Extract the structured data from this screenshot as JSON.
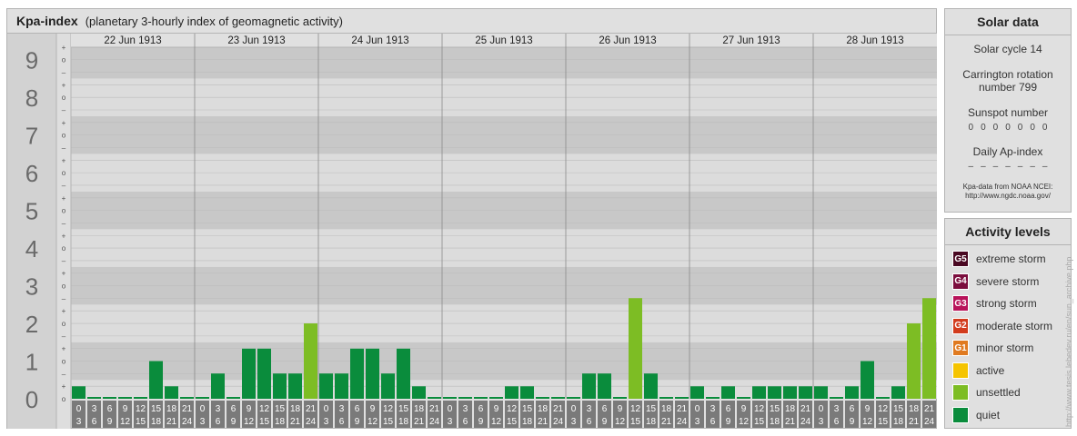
{
  "header": {
    "title": "Kpa-index",
    "subtitle": "(planetary 3-hourly index of geomagnetic activity)"
  },
  "chart_data": {
    "type": "bar",
    "y_major_labels": [
      "0",
      "1",
      "2",
      "3",
      "4",
      "5",
      "6",
      "7",
      "8",
      "9"
    ],
    "y_minor_labels": [
      "o",
      "+",
      "–"
    ],
    "ylim": [
      0,
      9.33
    ],
    "days": [
      "22 Jun 1913",
      "23 Jun 1913",
      "24 Jun 1913",
      "25 Jun 1913",
      "26 Jun 1913",
      "27 Jun 1913",
      "28 Jun 1913"
    ],
    "interval_starts": [
      "0",
      "3",
      "6",
      "9",
      "12",
      "15",
      "18",
      "21"
    ],
    "interval_ends": [
      "3",
      "6",
      "9",
      "12",
      "15",
      "18",
      "21",
      "24"
    ],
    "values": [
      [
        0.33,
        0,
        0,
        0,
        0,
        1,
        0.33,
        0
      ],
      [
        0,
        0.67,
        0,
        1.33,
        1.33,
        0.67,
        0.67,
        2
      ],
      [
        0.67,
        0.67,
        1.33,
        1.33,
        0.67,
        1.33,
        0.33,
        0
      ],
      [
        0,
        0,
        0,
        0,
        0.33,
        0.33,
        0,
        0
      ],
      [
        0,
        0.67,
        0.67,
        0,
        2.67,
        0.67,
        0,
        0
      ],
      [
        0.33,
        0,
        0.33,
        0,
        0.33,
        0.33,
        0.33,
        0.33
      ],
      [
        0.33,
        0,
        0.33,
        1,
        0,
        0.33,
        2,
        2.67
      ]
    ],
    "colors": {
      "quiet": "#0a8c3c",
      "unsettled": "#7dbd24",
      "active": "#f5c400",
      "minor": "#e07a20",
      "moderate": "#d23c1e",
      "strong": "#b8135a",
      "severe": "#7c0e3e",
      "extreme": "#4a0822"
    }
  },
  "solar": {
    "heading": "Solar data",
    "cycle": "Solar cycle 14",
    "carrington": "Carrington rotation number 799",
    "sunspot_label": "Sunspot number",
    "sunspot_values": [
      "0",
      "0",
      "0",
      "0",
      "0",
      "0",
      "0"
    ],
    "ap_label": "Daily Ap-index",
    "ap_values": [
      "–",
      "–",
      "–",
      "–",
      "–",
      "–",
      "–"
    ],
    "source_line1": "Kpa-data from NOAA NCEI:",
    "source_line2": "http://www.ngdc.noaa.gov/"
  },
  "activity": {
    "heading": "Activity levels",
    "items": [
      {
        "badge": "G5",
        "label": "extreme storm",
        "color": "#4a0822"
      },
      {
        "badge": "G4",
        "label": "severe storm",
        "color": "#7c0e3e"
      },
      {
        "badge": "G3",
        "label": "strong storm",
        "color": "#b8135a"
      },
      {
        "badge": "G2",
        "label": "moderate storm",
        "color": "#d23c1e"
      },
      {
        "badge": "G1",
        "label": "minor storm",
        "color": "#e07a20"
      },
      {
        "badge": "",
        "label": "active",
        "color": "#f5c400"
      },
      {
        "badge": "",
        "label": "unsettled",
        "color": "#7dbd24"
      },
      {
        "badge": "",
        "label": "quiet",
        "color": "#0a8c3c"
      }
    ]
  },
  "credit": "http://www.tesis.lebedev.ru/en/sun_archive.php"
}
